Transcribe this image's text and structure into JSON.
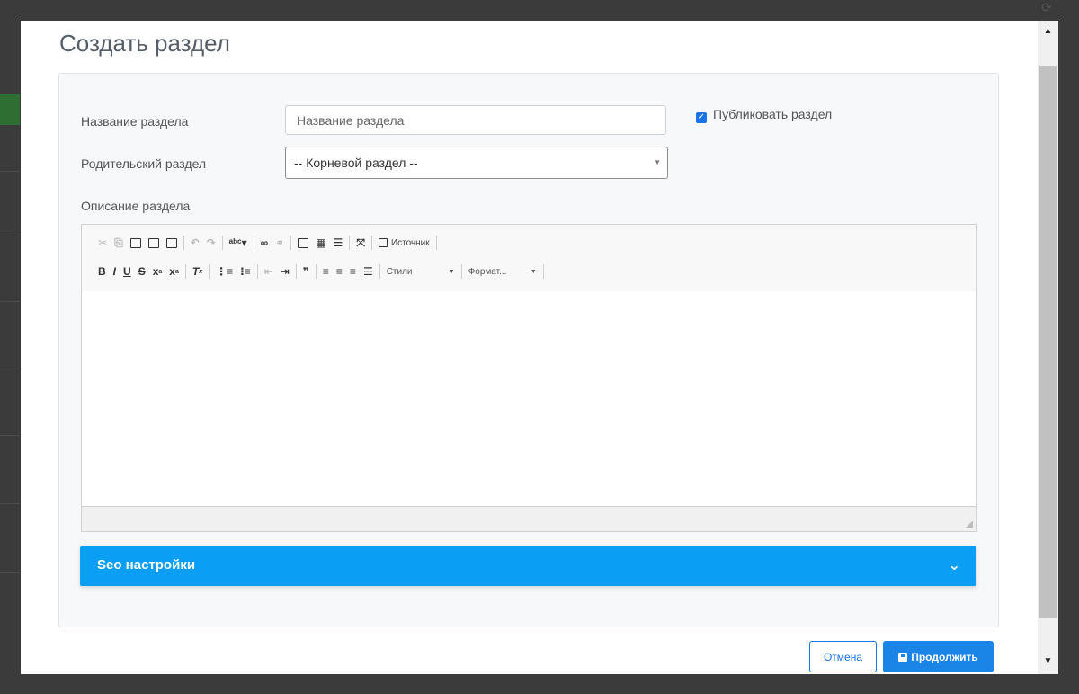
{
  "modal": {
    "title": "Создать раздел"
  },
  "form": {
    "name_label": "Название раздела",
    "name_placeholder": "Название раздела",
    "parent_label": "Родительский раздел",
    "parent_value": "-- Корневой раздел --",
    "publish_label": "Публиковать раздел",
    "publish_checked": true,
    "description_label": "Описание раздела"
  },
  "editor_toolbar": {
    "source_label": "Источник",
    "styles_label": "Стили",
    "format_label": "Формат..."
  },
  "seo": {
    "label": "Seo настройки"
  },
  "footer": {
    "cancel_label": "Отмена",
    "continue_label": "Продолжить"
  },
  "colors": {
    "accent": "#1b84e7",
    "seo_bar": "#0b9ef5"
  }
}
